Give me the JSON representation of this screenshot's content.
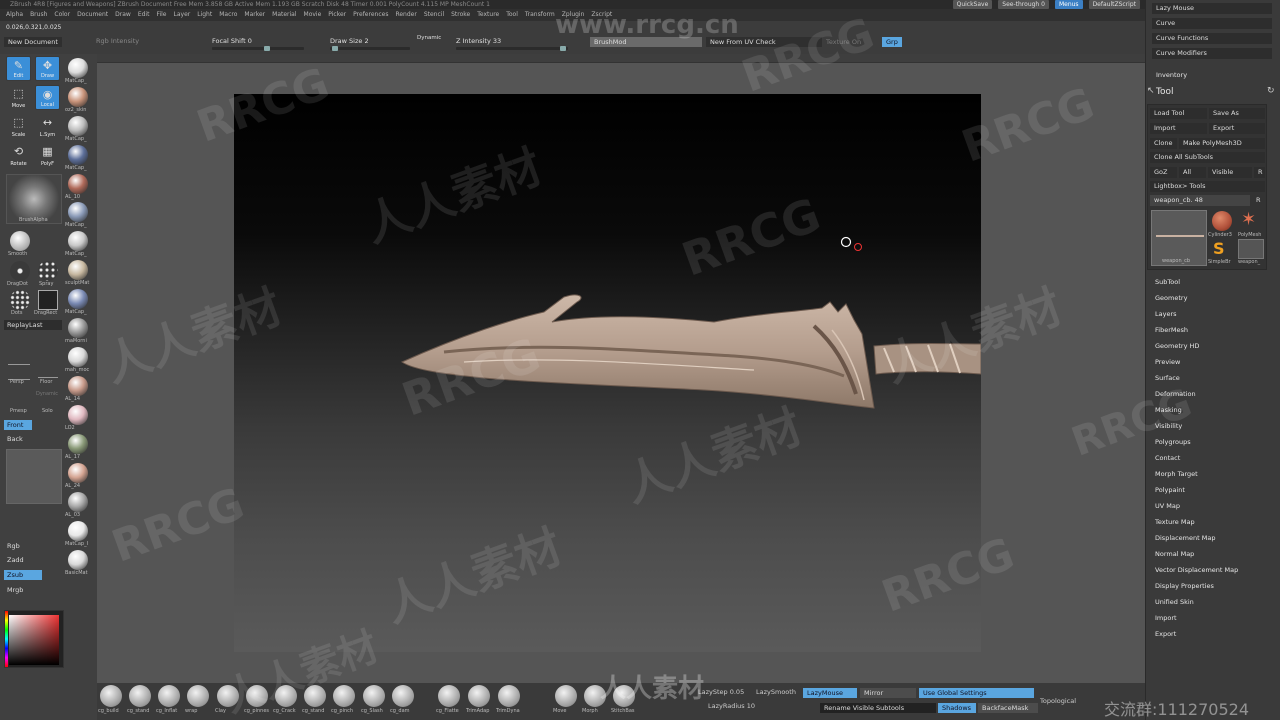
{
  "title_bar": "ZBrush 4R8 [Figures and Weapons] ZBrush Document   Free Mem 3.858 GB   Active Mem 1.193 GB   Scratch Disk 48   Timer 0.001   PolyCount 4.115 MP   MeshCount 1",
  "top_right": {
    "quicksave": "QuickSave",
    "seethrough": "See-through 0",
    "menus": "Menus",
    "script": "DefaultZScript"
  },
  "menu": [
    "Alpha",
    "Brush",
    "Color",
    "Document",
    "Draw",
    "Edit",
    "File",
    "Layer",
    "Light",
    "Macro",
    "Marker",
    "Material",
    "Movie",
    "Picker",
    "Preferences",
    "Render",
    "Stencil",
    "Stroke",
    "Texture",
    "Tool",
    "Transform",
    "Zplugin",
    "Zscript"
  ],
  "topbar": {
    "coords": "0.026,0.321,0.025",
    "new_document": "New Document",
    "rgb_intensity": "Rgb Intensity",
    "focal_shift": "Focal Shift 0",
    "draw_size": "Draw Size 2",
    "dynamic": "Dynamic",
    "z_intensity": "Z Intensity 33",
    "brushmod": "BrushMod",
    "new_from_uv": "New From UV Check",
    "texture_on": "Texture On",
    "grp": "Grp"
  },
  "left_tools": {
    "edit": "Edit",
    "draw": "Draw",
    "move": "Move",
    "scale": "Scale",
    "rotate": "Rotate",
    "local": "Local",
    "lsym": "L.Sym",
    "polyf": "PolyF",
    "brushalpha": "BrushAlpha",
    "smooth": "Smooth",
    "dragdot": "DragDot",
    "spray": "Spray",
    "dots": "Dots",
    "dragrect": "DragRect",
    "replaylast": "ReplayLast",
    "persp": "Persp",
    "floor": "Floor",
    "pmesp": "Pmesp",
    "solo": "Solo",
    "dynamic": "Dynamic",
    "front": "Front",
    "back": "Back",
    "rgb": "Rgb",
    "zadd": "Zadd",
    "zsub": "Zsub",
    "mrgb": "Mrgb"
  },
  "matcaps": [
    {
      "label": "MatCap_",
      "color": "#dcdcdc"
    },
    {
      "label": "oz2_skin",
      "color": "#c8937a"
    },
    {
      "label": "MatCap_",
      "color": "#bcbcbc"
    },
    {
      "label": "MatCap_",
      "color": "#5d6f9a"
    },
    {
      "label": "AL_10",
      "color": "#b06a5a"
    },
    {
      "label": "MatCap_",
      "color": "#8b9bb8"
    },
    {
      "label": "MatCap_",
      "color": "#c9c9c9"
    },
    {
      "label": "sculptMat",
      "color": "#c7b8a0"
    },
    {
      "label": "MatCap_",
      "color": "#7a8ab4"
    },
    {
      "label": "maMorni",
      "color": "#9a9a9a"
    },
    {
      "label": "mah_moc",
      "color": "#d8d8d8"
    },
    {
      "label": "AL_14",
      "color": "#c79a8a"
    },
    {
      "label": "LO2",
      "color": "#e0b8c0"
    },
    {
      "label": "AL_17",
      "color": "#8a9a78"
    },
    {
      "label": "AL_24",
      "color": "#d4a492"
    },
    {
      "label": "AL_03",
      "color": "#a8a8a8"
    },
    {
      "label": "MatCap_I",
      "color": "#e8e8e8"
    },
    {
      "label": "BasicMat",
      "color": "#d9d9d9"
    }
  ],
  "bottom_brushes": [
    "cg_build",
    "cg_stand",
    "cg_Inflat",
    "wrap",
    "Clay",
    "cg_pinnes",
    "cg_Crack",
    "cg_stand",
    "cg_pinch",
    "cg_Slash",
    "cg_dam",
    "cg_Flatte",
    "TrimAdap",
    "TrimDyna",
    "Move",
    "Morph",
    "StitchBas"
  ],
  "bottom_controls": {
    "lazystep": "LazyStep 0.05",
    "lazysmooth": "LazySmooth",
    "lazymouse": "LazyMouse",
    "mirror": "Mirror",
    "use_global": "Use Global Settings",
    "topological": "Topological",
    "lazyradius": "LazyRadius 10",
    "rename": "Rename Visible Subtools",
    "shadows": "Shadows",
    "backfacemask": "BackfaceMask"
  },
  "right_panel": {
    "top_items": [
      "Lazy Mouse",
      "Curve",
      "Curve Functions",
      "Curve Modifiers"
    ],
    "inventory": "Inventory",
    "tool_header": "Tool",
    "load_tool": "Load Tool",
    "save_as": "Save As",
    "import": "Import",
    "export": "Export",
    "clone": "Clone",
    "make_polymesh": "Make PolyMesh3D",
    "clone_all": "Clone All SubTools",
    "goz": "GoZ",
    "all": "All",
    "visible": "Visible",
    "r": "R",
    "lightbox_tools": "Lightbox> Tools",
    "weapon_slider": "weapon_cb. 48",
    "thumb_labels": [
      "weapon_cb",
      "Cylinder3",
      "PolyMesh",
      "SimpleBr",
      "weapon_"
    ],
    "sections": [
      "SubTool",
      "Geometry",
      "Layers",
      "FiberMesh",
      "Geometry HD",
      "Preview",
      "Surface",
      "Deformation",
      "Masking",
      "Visibility",
      "Polygroups",
      "Contact",
      "Morph Target",
      "Polypaint",
      "UV Map",
      "Texture Map",
      "Displacement Map",
      "Normal Map",
      "Vector Displacement Map",
      "Display Properties",
      "Unified Skin",
      "Import",
      "Export"
    ]
  },
  "watermarks": {
    "rrcg": "RRCG",
    "cn": "人人素材",
    "site": "www.rrcg.cn",
    "qq": "交流群:111270524"
  },
  "colors": {
    "accent": "#5aa6e0",
    "active_tool": "#3b8fd8",
    "blade": "#b49d8d"
  }
}
